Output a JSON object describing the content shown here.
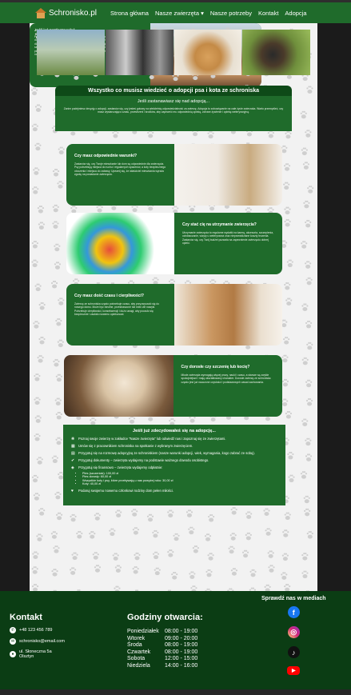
{
  "nav": {
    "brand": "Schronisko.pl",
    "links": [
      "Strona główna",
      "Nasze zwierzęta ▾",
      "Nasze potrzeby",
      "Kontakt",
      "Adopcja"
    ]
  },
  "title": "Wszystko co musisz wiedzieć o adopcji psa i kota ze schroniska",
  "intro": {
    "heading": "Jeśli zastanawiasz się nad adopcją...",
    "text": "Zanim podejmiesz decyzję o adopcji, zastanów się, czy jesteś gotowy na wieloletnią odpowiedzialność za zwierzę. Adopcja to zobowiązanie na całe życie zwierzaka. Warto przemyśleć, czy masz wystarczająco czasu, przestrzeni i środków, aby zapewnić mu odpowiednią opiekę, zdrowe żywienie i opiekę weterynaryjną."
  },
  "blocks": [
    {
      "heading": "Czy masz odpowiednie warunki?",
      "text": "Zastanów się, czy Twoje mieszkanie lub dom są odpowiednie dla zwierzęcia. Psy potrzebują miejsca do ruchu i regularnych spacerów, a koty bezpiecznego otoczenia i miejsca do zabawy. Upewnij się, że właściciel mieszkania wyraża zgodę na posiadanie zwierzęcia."
    },
    {
      "heading": "Czy stać cię na utrzymanie zwierzęcia?",
      "text": "Utrzymanie zwierzęcia to regularne wydatki na karmę, akcesoria, szczepienia, odrobaczanie, wizyty u weterynarza oraz nieprzewidziane koszty leczenia. Zastanów się, czy Twój budżet pozwala na zapewnienie zwierzęciu dobrej opieki."
    },
    {
      "heading": "Czy masz dość czasu i cierpliwości?",
      "text": "Zwierzę ze schroniska często potrzebuje czasu, aby przyzwyczaić się do nowego domu. Może być nieufne, przestraszone lub mieć złe nawyki. Potrzebuje cierpliwości, konsekwencji i dużo uwagi, aby poczuło się bezpiecznie i zaufało nowemu opiekunowi."
    },
    {
      "heading": "Czy dorosłe czy szczenię lub kocię?",
      "text": "Młode zwierzęta wymagają więcej pracy, nauki i czasu, a starsze są zwykle spokojniejsze i mają ukształtowany charakter. Dorosłe zwierzę ze schroniska często jest już nauczone czystości i podstawowych zasad zachowania."
    }
  ],
  "steps": {
    "heading": "Jeśli już zdecydowałeś się na adopcję...",
    "items": [
      {
        "icon": "paw-icon",
        "text": "Poznaj swoje zwierzę w zakładce \"Nasze zwierzęta\" lub odwiedź nas i zapoznaj się ze zwierzętami."
      },
      {
        "icon": "calendar-icon",
        "text": "Umów się z pracownikiem schroniska na spotkanie z wybranym zwierzęciem."
      },
      {
        "icon": "document-icon",
        "text": "Przygotuj się na rozmowę adopcyjną ze schroniskiem (nasze warunki adopcji, wiek, wymagania, kogo zabrać ze sobą)."
      },
      {
        "icon": "check-icon",
        "text": "Przygotuj dokumenty – zwierzęta wydajemy na podstawie ważnego dowodu osobistego."
      },
      {
        "icon": "wallet-icon",
        "text": "Przygotuj się finansowo – zwierzęta wydajemy odpłatnie:",
        "list": [
          "Pies (szczeniak): 100,00 zł",
          "Pies dorosły: 60,00 zł",
          "Wszystkie koty i psy, które przebywają u nas powyżej roku: 30,00 zł",
          "Koty: 40,00 zł"
        ]
      },
      {
        "icon": "heart-icon",
        "text": "Podaruj swojemu nowemu członkowi rodziny dom pełen miłości."
      }
    ]
  },
  "last": {
    "heading": "Jeśli już zaadoptowałeś...",
    "text": "Po przyjęciu zwierzęcia do domu daj mu czas na aklimatyzację. Zapewnij mu spokojne miejsce do odpoczynku, miskę z wodą i jedzeniem oraz legowisko. Pierwsze dni mogą być stresujące dla zwierzaka, dlatego bądź cierpliwy i wyrozumiały. Pamiętaj o wizycie u weterynarza, szczepieniach i odrobaczaniu. Jeśli adoptowałeś psa, regularnie wychodź z nim na spacery i poświęcaj mu czas na zabawę. W razie jakichkolwiek problemów lub pytań skontaktuj się z nami – chętnie pomożemy."
  },
  "footer": {
    "contact_heading": "Kontakt",
    "phone": "+48 123 456 789",
    "email": "schronisko@email.com",
    "address_line1": "ul. Słoneczna 5a",
    "address_line2": "Olsztyn",
    "hours_heading": "Godziny otwarcia:",
    "hours": [
      {
        "day": "Poniedziałek",
        "time": "08:00 - 19:00"
      },
      {
        "day": "Wtorek",
        "time": "09:00 - 20:00"
      },
      {
        "day": "Środa",
        "time": "08:00 - 19:00"
      },
      {
        "day": "Czwartek",
        "time": "08:00 - 19:00"
      },
      {
        "day": "Sobota",
        "time": "12:00 - 15:00"
      },
      {
        "day": "Niedziela",
        "time": "14:00 - 16:00"
      }
    ],
    "social_heading": "Sprawdź nas w mediach",
    "socials": [
      {
        "name": "facebook-icon",
        "glyph": "f",
        "color": "#1877f2"
      },
      {
        "name": "instagram-icon",
        "glyph": "◎",
        "color": "#d6249f"
      },
      {
        "name": "tiktok-icon",
        "glyph": "♪",
        "color": "#111111"
      },
      {
        "name": "youtube-icon",
        "glyph": "▶",
        "color": "#ff0000"
      }
    ]
  },
  "colors": {
    "primary": "#1f6b2b",
    "dark": "#0b3d14",
    "title": "#0e4a18"
  }
}
